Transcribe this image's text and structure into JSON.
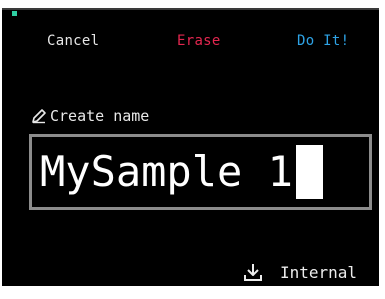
{
  "topbar": {
    "cancel_label": "Cancel",
    "erase_label": "Erase",
    "doit_label": "Do It!"
  },
  "prompt": {
    "label": "Create name",
    "icon": "pencil-icon"
  },
  "name_field": {
    "value": "MySample 1"
  },
  "storage": {
    "label": "Internal",
    "icon": "download-icon"
  },
  "colors": {
    "background": "#000000",
    "cancel": "#e6e6e6",
    "erase": "#e3264f",
    "doit": "#2ea3e6",
    "accent_dot": "#2fd0a3",
    "field_border": "#8c8c8c"
  }
}
